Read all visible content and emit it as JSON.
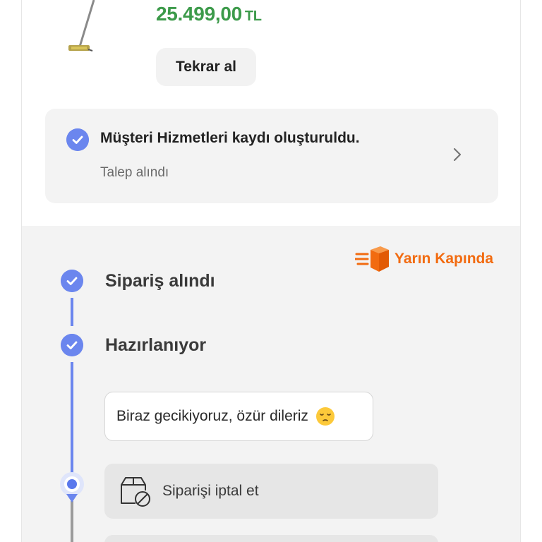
{
  "product": {
    "price_value": "25.499,00",
    "price_currency": "TL",
    "rebuy_label": "Tekrar al"
  },
  "customer_service": {
    "title": "Müşteri Hizmetleri kaydı oluşturuldu.",
    "subtitle": "Talep alındı"
  },
  "delivery_badge": {
    "label": "Yarın Kapında"
  },
  "timeline": {
    "steps": [
      {
        "label": "Sipariş alındı",
        "status": "done"
      },
      {
        "label": "Hazırlanıyor",
        "status": "done"
      }
    ],
    "delay_message": "Biraz gecikiyoruz, özür dileriz",
    "cancel_label": "Siparişi iptal et"
  },
  "colors": {
    "accent": "#6b86ee",
    "price": "#3c9a4a",
    "badge": "#f26b10"
  }
}
